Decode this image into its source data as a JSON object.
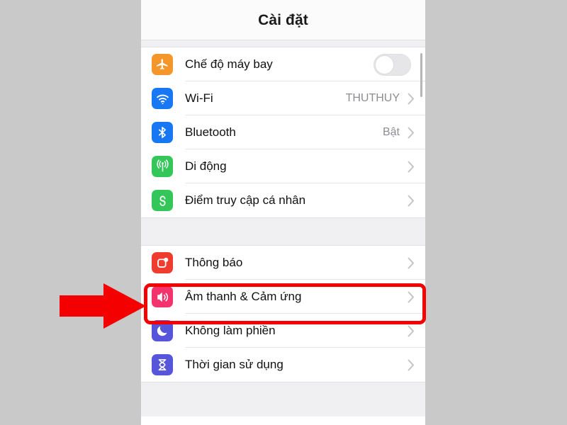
{
  "app": {
    "title": "Cài đặt",
    "background_color": "#c9c9c9",
    "screen_color": "#ffffff"
  },
  "annotation": {
    "highlight_color": "#f40000",
    "arrow_color": "#f40000",
    "arrow_name": "red-arrow-pointing-right",
    "highlighted_row_label": "Âm thanh & Cảm ứng"
  },
  "groups": [
    {
      "name": "connectivity",
      "rows": [
        {
          "label": "Chế độ máy bay",
          "icon": "airplane-icon",
          "icon_color": "#f5962a",
          "accessory": "toggle",
          "toggle_on": false,
          "value": ""
        },
        {
          "label": "Wi-Fi",
          "icon": "wifi-icon",
          "icon_color": "#1878f3",
          "accessory": "chevron",
          "value": "THUTHUY"
        },
        {
          "label": "Bluetooth",
          "icon": "bluetooth-icon",
          "icon_color": "#1878f3",
          "accessory": "chevron",
          "value": "Bật"
        },
        {
          "label": "Di động",
          "icon": "cellular-icon",
          "icon_color": "#34c659",
          "accessory": "chevron",
          "value": ""
        },
        {
          "label": "Điểm truy cập cá nhân",
          "icon": "personal-hotspot-icon",
          "icon_color": "#34c659",
          "accessory": "chevron",
          "value": ""
        }
      ]
    },
    {
      "name": "system",
      "rows": [
        {
          "label": "Thông báo",
          "icon": "notifications-icon",
          "icon_color": "#f03c2e",
          "accessory": "chevron",
          "value": ""
        },
        {
          "label": "Âm thanh & Cảm ứng",
          "icon": "sounds-haptics-icon",
          "icon_color": "#f4336d",
          "accessory": "chevron",
          "value": "",
          "highlighted": true
        },
        {
          "label": "Không làm phiền",
          "icon": "do-not-disturb-moon-icon",
          "icon_color": "#5755d9",
          "accessory": "chevron",
          "value": ""
        },
        {
          "label": "Thời gian sử dụng",
          "icon": "screen-time-hourglass-icon",
          "icon_color": "#5755d9",
          "accessory": "chevron",
          "value": ""
        }
      ]
    }
  ]
}
